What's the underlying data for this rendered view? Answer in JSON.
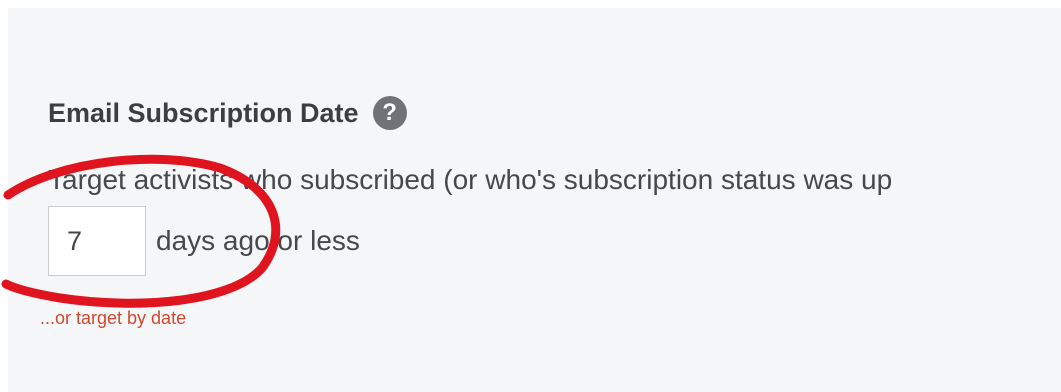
{
  "section": {
    "title": "Email Subscription Date",
    "help_icon": "question-circle-icon"
  },
  "description": "Target activists who subscribed (or who's subscription status was up",
  "days_filter": {
    "value": "7",
    "suffix": "days ago or less"
  },
  "date_link": "...or target by date",
  "colors": {
    "background": "#f5f6f8",
    "link": "#d0482d",
    "annotation": "#e0141e"
  }
}
